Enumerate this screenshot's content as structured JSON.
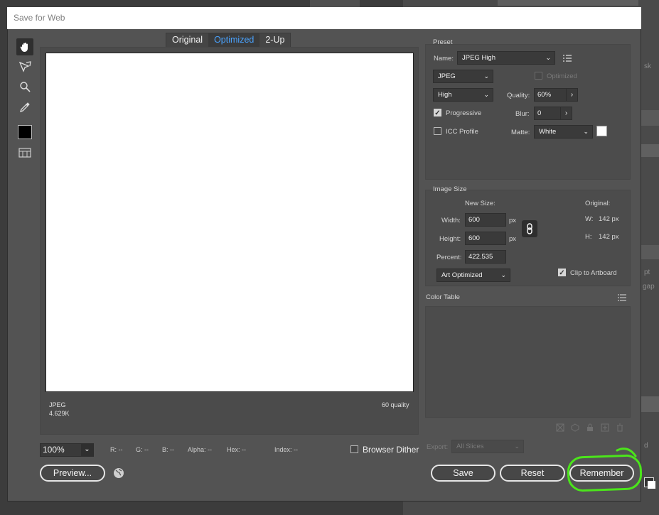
{
  "dialog": {
    "title": "Save for Web"
  },
  "tabs": [
    "Original",
    "Optimized",
    "2-Up"
  ],
  "preview": {
    "format": "JPEG",
    "size": "4.629K",
    "quality": "60 quality"
  },
  "preset": {
    "section": "Preset",
    "name_label": "Name:",
    "name_value": "JPEG High",
    "format_value": "JPEG",
    "optimized_label": "Optimized",
    "compression_value": "High",
    "quality_label": "Quality:",
    "quality_value": "60%",
    "progressive_label": "Progressive",
    "blur_label": "Blur:",
    "blur_value": "0",
    "icc_label": "ICC Profile",
    "matte_label": "Matte:",
    "matte_value": "White"
  },
  "image_size": {
    "section": "Image Size",
    "new_size_label": "New Size:",
    "original_label": "Original:",
    "width_label": "Width:",
    "width_value": "600",
    "height_label": "Height:",
    "height_value": "600",
    "px": "px",
    "orig_w_label": "W:",
    "orig_w_value": "142 px",
    "orig_h_label": "H:",
    "orig_h_value": "142 px",
    "percent_label": "Percent:",
    "percent_value": "422.535",
    "resample_value": "Art Optimized",
    "clip_label": "Clip to Artboard"
  },
  "color_table": {
    "section": "Color Table"
  },
  "export": {
    "label": "Export:",
    "value": "All Slices"
  },
  "statusbar": {
    "zoom": "100%",
    "r": "R: --",
    "g": "G: --",
    "b": "B: --",
    "alpha": "Alpha: --",
    "hex": "Hex: --",
    "index": "Index: --",
    "dither_label": "Browser Dither"
  },
  "buttons": {
    "preview": "Preview...",
    "save": "Save",
    "reset": "Reset",
    "remember": "Remember"
  },
  "background": {
    "text1": "sk",
    "text2": "pt",
    "text3": "gap",
    "text4": "d"
  },
  "colors": {
    "highlight": "#4be51b",
    "accent": "#4aa3ff",
    "dialog_bg": "#535353"
  }
}
